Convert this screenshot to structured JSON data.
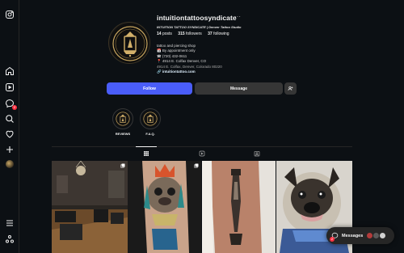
{
  "rail": {
    "badge_count": "2"
  },
  "profile": {
    "username": "intuitiontattoosyndicate",
    "more_symbol": "···",
    "posts_count": "14",
    "posts_label": "posts",
    "followers_count": "315",
    "followers_label": "followers",
    "following_count": "37",
    "following_label": "following",
    "display_name": "INTUITION TATTOO SYNDICATE | Denver Tattoo Studio",
    "bio_lines": [
      "tattoo and piercing shop",
      "By appointment only",
      "(720) 432-0611",
      "4914 E. Colfax Denver, CO",
      "4914 E. Colfax, Denver, Colorado 80220"
    ],
    "link": "intuitiontattoo.com"
  },
  "actions": {
    "follow_label": "Follow",
    "message_label": "Message"
  },
  "highlights": [
    {
      "label": "REVIEWS"
    },
    {
      "label": "F.A.Q."
    }
  ],
  "messages": {
    "label": "Messages",
    "badge_count": "2"
  },
  "colors": {
    "background": "#0c1014",
    "follow_button": "#4a5df9",
    "secondary_button": "#363636",
    "notification": "#ff3040"
  }
}
